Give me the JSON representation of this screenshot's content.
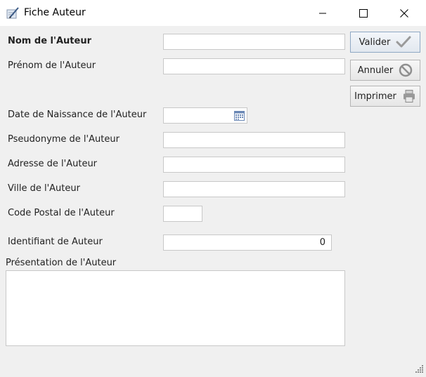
{
  "window": {
    "title": "Fiche Auteur"
  },
  "form": {
    "nom_label": "Nom de l'Auteur",
    "prenom_label": "Prénom de l'Auteur",
    "naissance_label": "Date de Naissance de l'Auteur",
    "pseudonyme_label": "Pseudonyme de l'Auteur",
    "adresse_label": "Adresse de l'Auteur",
    "ville_label": "Ville de l'Auteur",
    "code_postal_label": "Code Postal de l'Auteur",
    "identifiant_label": "Identifiant de Auteur",
    "identifiant_value": "0",
    "presentation_label": "Présentation de l'Auteur"
  },
  "buttons": {
    "valider": "Valider",
    "annuler": "Annuler",
    "imprimer": "Imprimer"
  },
  "icons": {
    "valider": "checkmark-icon",
    "annuler": "cancel-icon",
    "imprimer": "printer-icon",
    "date": "calendar-icon"
  }
}
